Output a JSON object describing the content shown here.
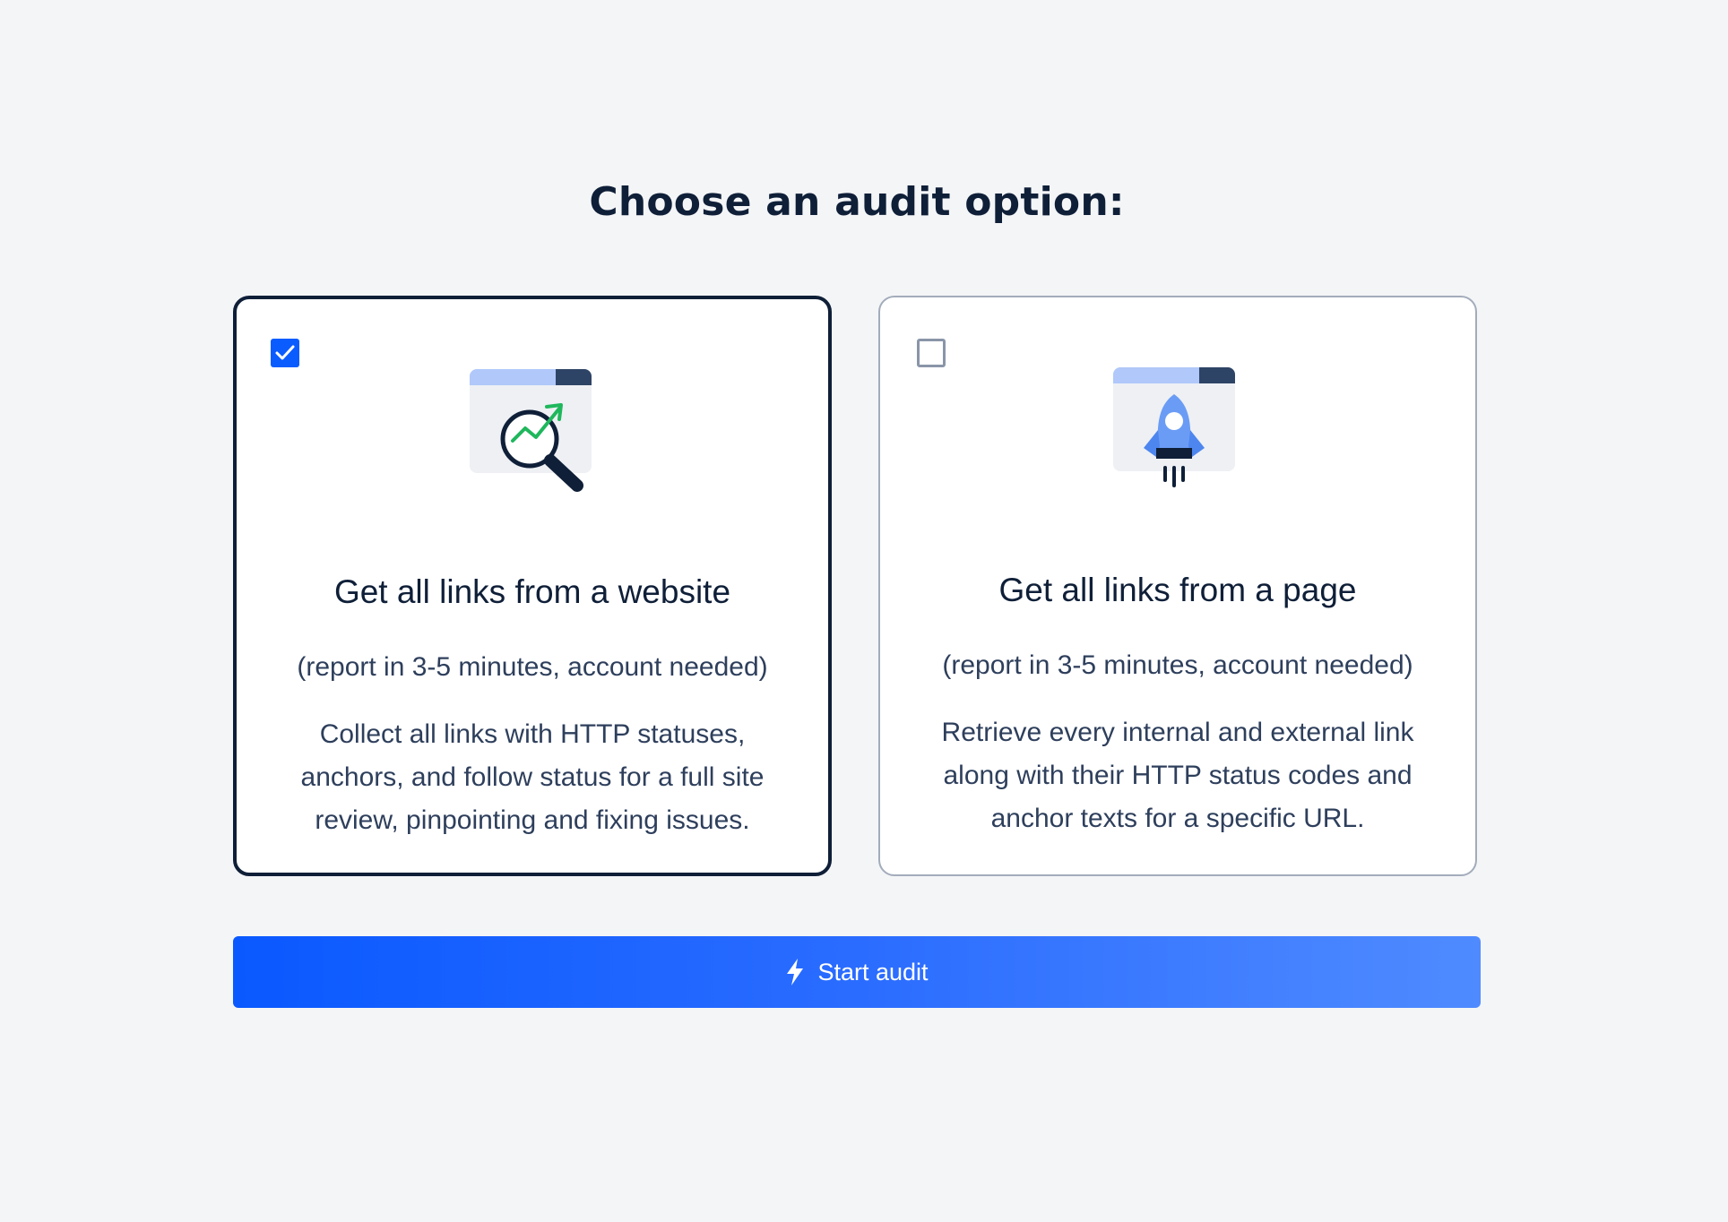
{
  "page": {
    "title": "Choose an audit option:"
  },
  "options": [
    {
      "icon": "website-analytics-icon",
      "title": "Get all links from a website",
      "subtitle": "(report in 3-5 minutes, account needed)",
      "description": "Collect all links with HTTP statuses, anchors, and follow status for a full site review, pinpointing and fixing issues.",
      "selected": true
    },
    {
      "icon": "rocket-page-icon",
      "title": "Get all links from a page",
      "subtitle": "(report in 3-5 minutes, account needed)",
      "description": "Retrieve every internal and external link along with their HTTP status codes and anchor texts for a specific URL.",
      "selected": false
    }
  ],
  "actions": {
    "start_label": "Start audit",
    "start_icon": "lightning-icon"
  },
  "colors": {
    "accent": "#0a5cff",
    "text_dark": "#0f1f38",
    "text_body": "#2e3f5c",
    "background": "#f4f5f7"
  }
}
